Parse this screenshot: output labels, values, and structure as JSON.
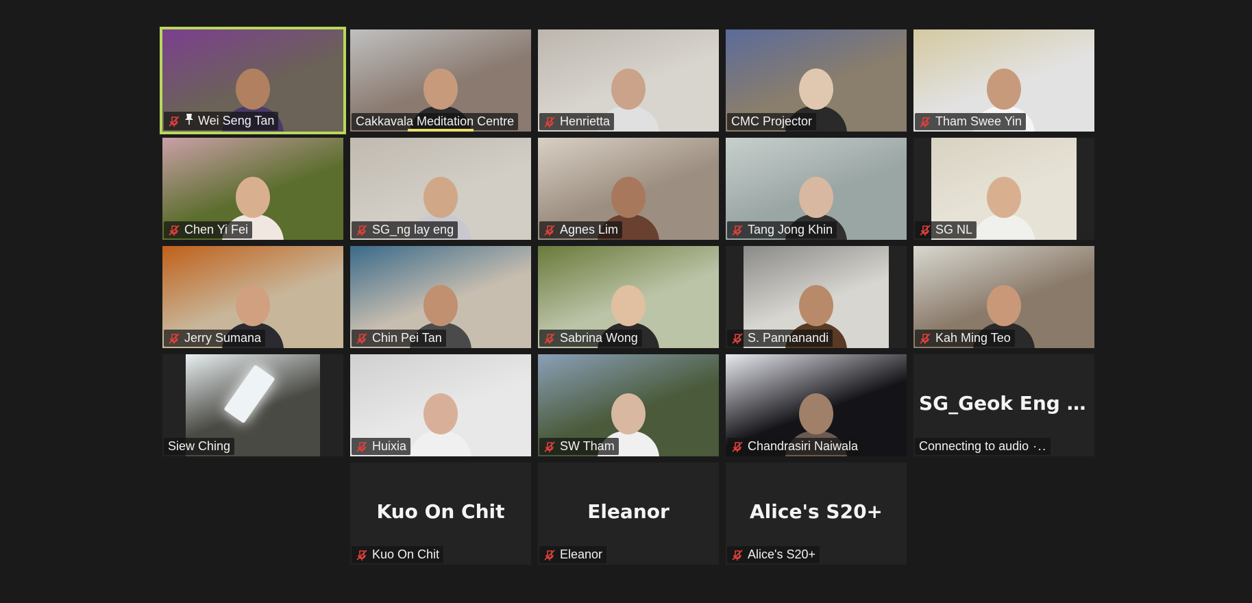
{
  "participants": [
    {
      "name": "Wei Seng Tan",
      "muted": true,
      "pinned": true,
      "active": true,
      "bg": "#6b6258",
      "accent": "#7b3f8f",
      "skin": "#b08060",
      "shirt": "#4a3a6a"
    },
    {
      "name": "Cakkavala Meditation Centre",
      "muted": false,
      "speaking": true,
      "bg": "#8a7a70",
      "accent": "#c0c0c0",
      "skin": "#c89a7c",
      "shirt": "#2a2a2a"
    },
    {
      "name": "Henrietta",
      "muted": true,
      "bg": "#d8d4ce",
      "accent": "#bcb6ae",
      "skin": "#caa38a",
      "shirt": "#e0e0e0"
    },
    {
      "name": "CMC Projector",
      "muted": false,
      "bg": "#8a7e6c",
      "accent": "#5b6b9a",
      "skin": "#e0c8b0",
      "shirt": "#2a2a2a"
    },
    {
      "name": "Tham Swee Yin",
      "muted": true,
      "bg": "#e2e2e2",
      "accent": "#d4c9a0",
      "skin": "#c89a7c",
      "shirt": "#f5f5f5"
    },
    {
      "name": "Chen Yi Fei",
      "muted": true,
      "bg": "#5c6e2e",
      "accent": "#caa0a8",
      "skin": "#d8b090",
      "shirt": "#f0e8e0"
    },
    {
      "name": "SG_ng lay eng",
      "muted": true,
      "bg": "#d2cdc5",
      "accent": "#c0bab0",
      "skin": "#d0a888",
      "shirt": "#c8c8d0"
    },
    {
      "name": "Agnes Lim",
      "muted": true,
      "bg": "#9c8e80",
      "accent": "#d8d0c4",
      "skin": "#a8785c",
      "shirt": "#6a4030"
    },
    {
      "name": "Tang Jong Khin",
      "muted": true,
      "bg": "#9aa6a4",
      "accent": "#c8cfcd",
      "skin": "#d8b8a0",
      "shirt": "#303030"
    },
    {
      "name": "SG NL",
      "muted": true,
      "bg": "#e6e2d6",
      "accent": "#d8d2c0",
      "skin": "#d8b090",
      "shirt": "#f0f0ec",
      "narrow": true
    },
    {
      "name": "Jerry Sumana",
      "muted": true,
      "bg": "#c8b69a",
      "accent": "#c0601a",
      "skin": "#d0a080",
      "shirt": "#2a2a30"
    },
    {
      "name": "Chin Pei Tan",
      "muted": true,
      "bg": "#c8beb0",
      "accent": "#3a6a8a",
      "skin": "#c09070",
      "shirt": "#4a4a4a"
    },
    {
      "name": "Sabrina Wong",
      "muted": true,
      "bg": "#bcc4a8",
      "accent": "#6a7a3a",
      "skin": "#e0c0a0",
      "shirt": "#2a2a2a"
    },
    {
      "name": "S. Pannanandi",
      "muted": true,
      "bg": "#d8d6d0",
      "accent": "#8a8a88",
      "skin": "#b88a6a",
      "shirt": "#5a3a24",
      "narrow": true
    },
    {
      "name": "Kah Ming Teo",
      "muted": true,
      "bg": "#8a7a6a",
      "accent": "#d8d8d0",
      "skin": "#c89878",
      "shirt": "#2a2a2a"
    },
    {
      "name": "Siew Ching",
      "muted": false,
      "bg": "#4a4a44",
      "accent": "#e8eef0",
      "skin": "#4a4a44",
      "shirt": "#4a4a44",
      "narrow2": true,
      "noperson": true
    },
    {
      "name": "Huixia",
      "muted": true,
      "bg": "#e8e8e8",
      "accent": "#d0d0d0",
      "skin": "#d8b09a",
      "shirt": "#f0f0f0"
    },
    {
      "name": "SW Tham",
      "muted": true,
      "bg": "#4a5a3a",
      "accent": "#8aa0b8",
      "skin": "#d8b8a0",
      "shirt": "#f0f0f0"
    },
    {
      "name": "Chandrasiri Naiwala",
      "muted": true,
      "bg": "#141418",
      "accent": "#e8e8f0",
      "skin": "#a08068",
      "shirt": "#6a5a50"
    },
    {
      "name": "Connecting to audio",
      "big": "SG_Geok Eng C...",
      "muted": false,
      "connecting": true,
      "nocam": true
    },
    {
      "empty": true
    },
    {
      "name": "Kuo On Chit",
      "big": "Kuo On Chit",
      "muted": true,
      "nocam": true
    },
    {
      "name": "Eleanor",
      "big": "Eleanor",
      "muted": true,
      "nocam": true
    },
    {
      "name": "Alice's S20+",
      "big": "Alice's S20+",
      "muted": true,
      "nocam": true
    },
    {
      "empty": true
    }
  ],
  "ui": {
    "connecting_dots": "·․.",
    "colors": {
      "active_border": "#b9d85a",
      "speaker_bar": "#e8e06a",
      "mute_icon": "#e0403a",
      "background": "#1a1a1a",
      "tile": "#232323"
    }
  }
}
